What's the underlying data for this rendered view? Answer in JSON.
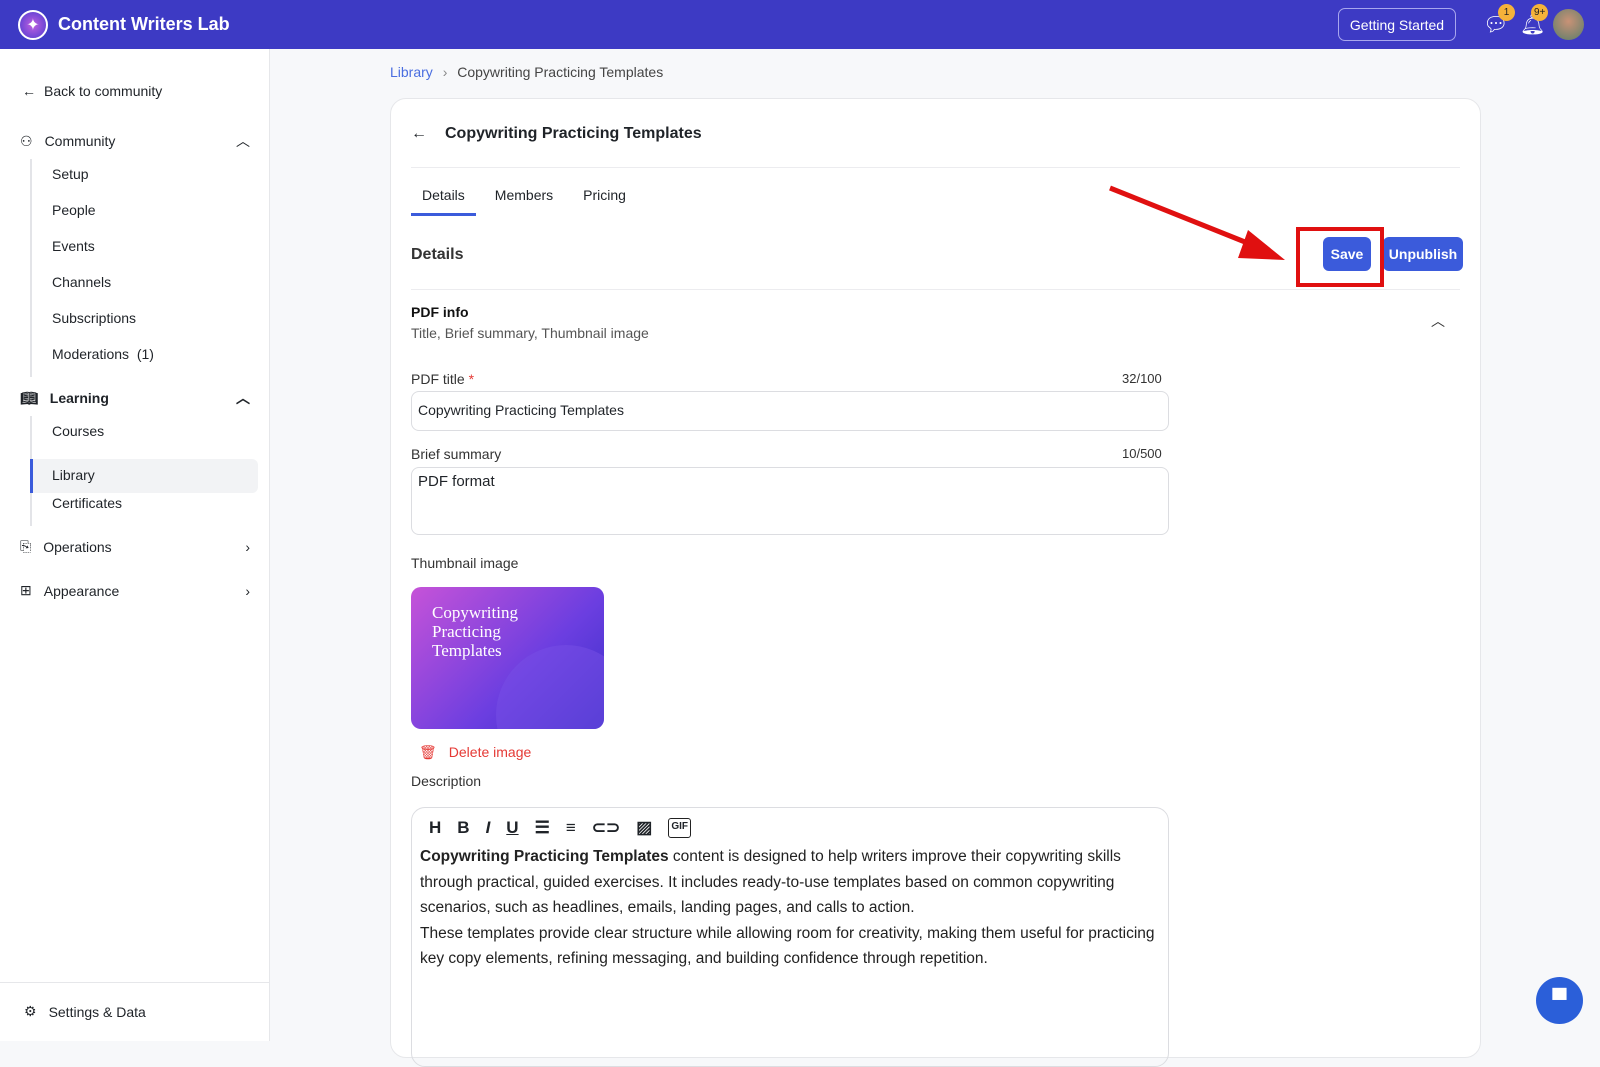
{
  "topbar": {
    "brand": "Content Writers Lab",
    "getting_started": "Getting Started",
    "messages_badge": "1",
    "notifications_badge": "9+"
  },
  "sidebar": {
    "back": "Back to community",
    "community": "Community",
    "community_items": [
      "Setup",
      "People",
      "Events",
      "Channels",
      "Subscriptions",
      "Moderations  (1)"
    ],
    "learning": "Learning",
    "learning_items": [
      "Courses",
      "Library",
      "Certificates"
    ],
    "operations": "Operations",
    "appearance": "Appearance",
    "settings": "Settings & Data"
  },
  "breadcrumb": {
    "root": "Library",
    "current": "Copywriting Practicing Templates"
  },
  "page": {
    "title": "Copywriting Practicing Templates",
    "tabs": [
      "Details",
      "Members",
      "Pricing"
    ],
    "section": "Details",
    "save": "Save",
    "unpublish": "Unpublish",
    "pdf_info": {
      "title": "PDF info",
      "subtitle": "Title, Brief summary, Thumbnail image"
    },
    "pdf_title_label": "PDF title",
    "required": "*",
    "pdf_title_count": "32/100",
    "pdf_title_value": "Copywriting Practicing Templates",
    "summary_label": "Brief summary",
    "summary_count": "10/500",
    "summary_value": "PDF format",
    "thumbnail_label": "Thumbnail image",
    "thumbnail_text": "Copywriting Practicing Templates",
    "delete_image": "Delete image",
    "description_label": "Description",
    "toolbar": [
      "H",
      "B",
      "I",
      "U",
      "☰",
      "≡",
      "⊂⊃",
      "▨",
      "GIF"
    ],
    "description_bold": "Copywriting Practicing Templates",
    "description_p1": " content is designed to help writers improve their copywriting skills through practical, guided exercises. It includes ready-to-use templates based on common copywriting scenarios, such as headlines, emails, landing pages, and calls to action.",
    "description_p2": "These templates provide clear structure while allowing room for creativity, making them useful for practicing key copy elements, refining messaging, and building confidence through repetition."
  }
}
